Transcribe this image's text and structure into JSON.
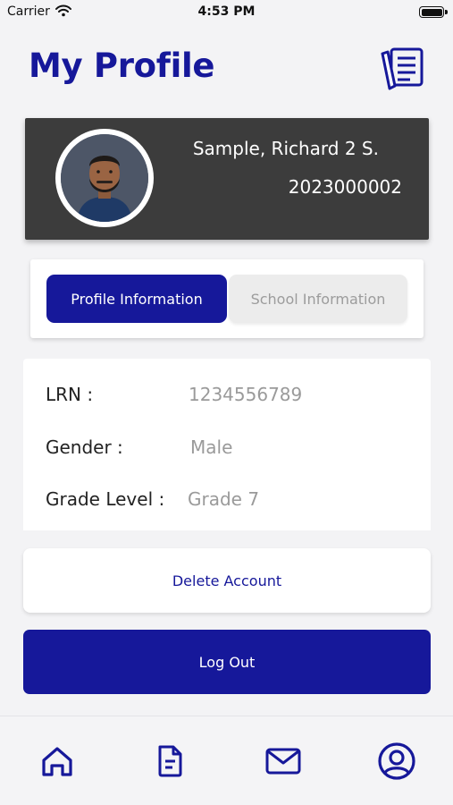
{
  "status_bar": {
    "carrier": "Carrier",
    "time": "4:53 PM",
    "icons": [
      "wifi-icon",
      "battery-icon"
    ]
  },
  "header": {
    "title": "My Profile",
    "icon": "notebook-icon"
  },
  "profile": {
    "name": "Sample, Richard 2 S.",
    "id": "2023000002",
    "avatar": "avatar"
  },
  "tabs": [
    {
      "label": "Profile Information",
      "active": true
    },
    {
      "label": "School Information",
      "active": false
    }
  ],
  "info": {
    "lrn_label": "LRN :",
    "lrn_value": "1234556789",
    "gender_label": "Gender :",
    "gender_value": "Male",
    "grade_label": "Grade Level :",
    "grade_value": "Grade 7"
  },
  "actions": {
    "delete_label": "Delete Account",
    "logout_label": "Log Out"
  },
  "nav": {
    "items": [
      "home-icon",
      "document-icon",
      "mail-icon",
      "profile-icon"
    ]
  },
  "colors": {
    "primary": "#16189a",
    "card_dark": "#3c3c3c",
    "background": "#f3f3f5"
  }
}
